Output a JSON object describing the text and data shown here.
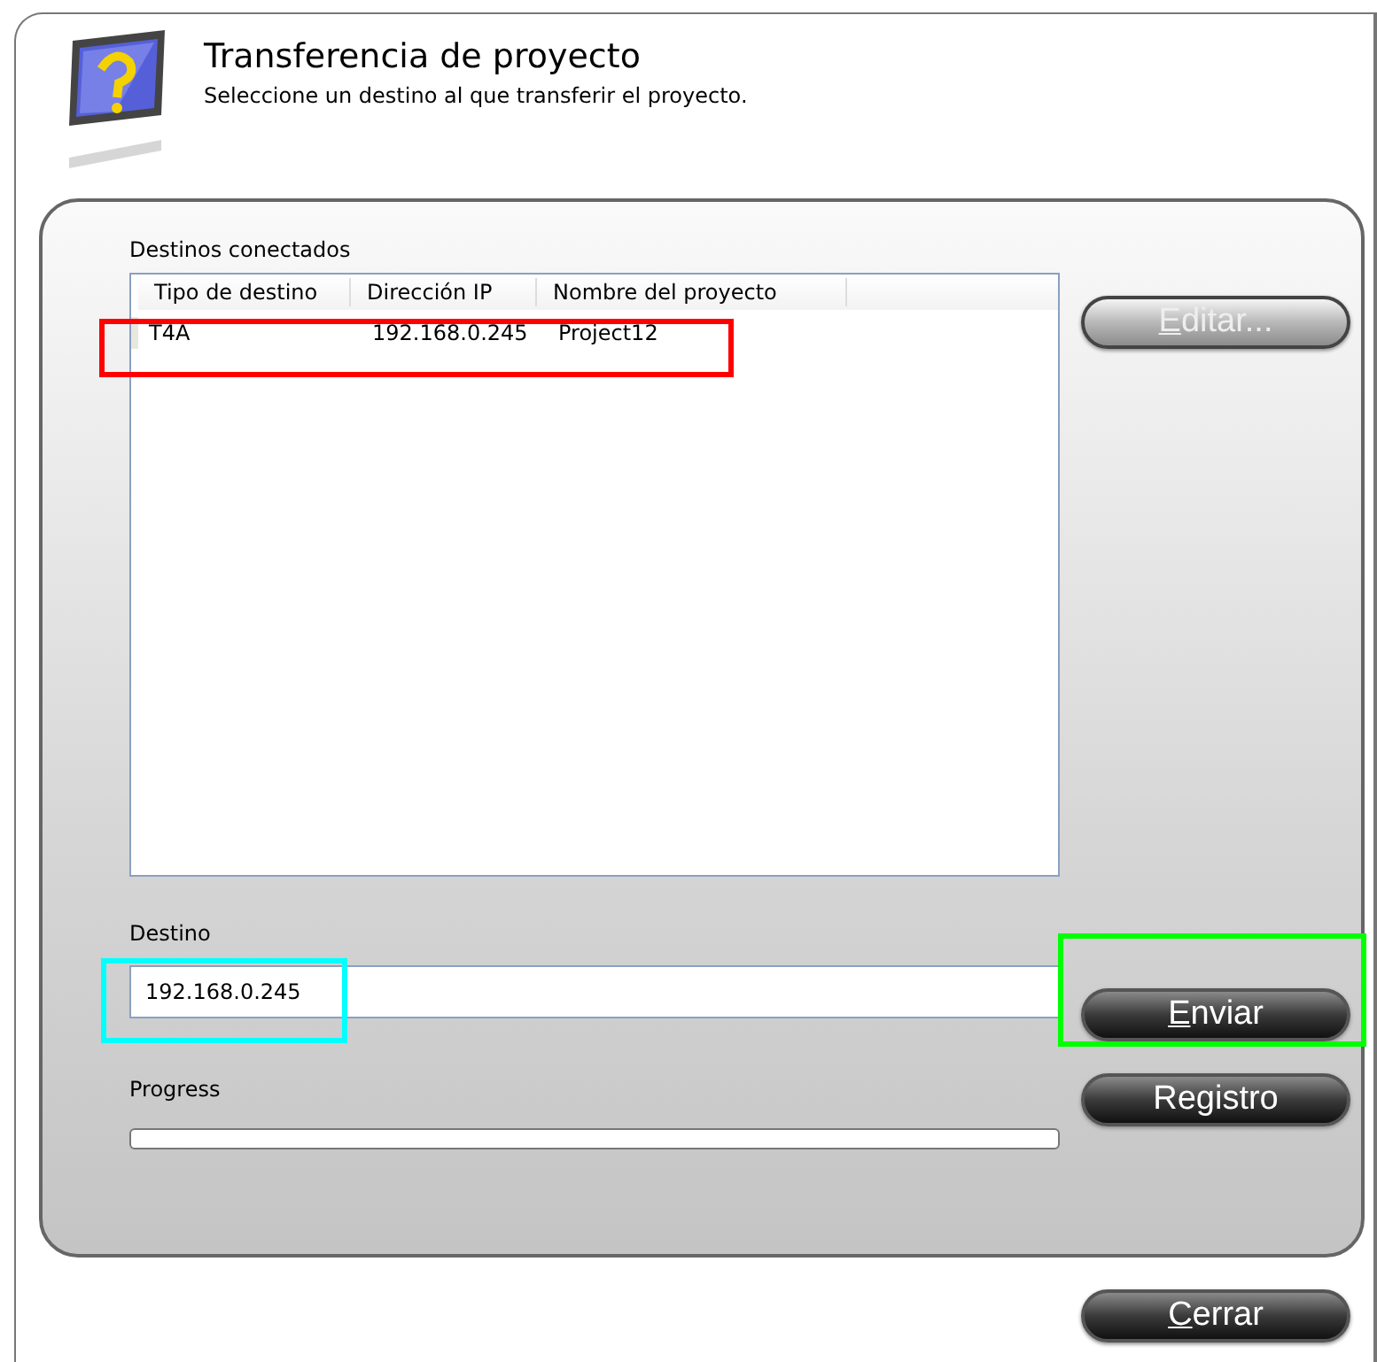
{
  "header": {
    "title": "Transferencia de proyecto",
    "subtitle": "Seleccione un destino al que transferir el proyecto."
  },
  "targets": {
    "label": "Destinos conectados",
    "columns": [
      "Tipo de destino",
      "Dirección IP",
      "Nombre del proyecto"
    ],
    "rows": [
      {
        "cells": [
          "T4A",
          "192.168.0.245",
          "Project12"
        ]
      }
    ]
  },
  "edit_button": {
    "label": "Editar...",
    "disabled": true,
    "underline_first": true
  },
  "destination": {
    "label": "Destino",
    "value": "192.168.0.245"
  },
  "send_button": {
    "label": "Enviar",
    "disabled": false,
    "underline_first": true
  },
  "log_button": {
    "label": "Registro",
    "disabled": false,
    "underline_first": false
  },
  "progress": {
    "label": "Progress",
    "level": 0
  },
  "close_button": {
    "label": "Cerrar",
    "disabled": false,
    "underline_first": true
  },
  "annotations": [
    {
      "color": "#ff0000"
    },
    {
      "color": "#00ffff"
    },
    {
      "color": "#00ff00"
    }
  ]
}
